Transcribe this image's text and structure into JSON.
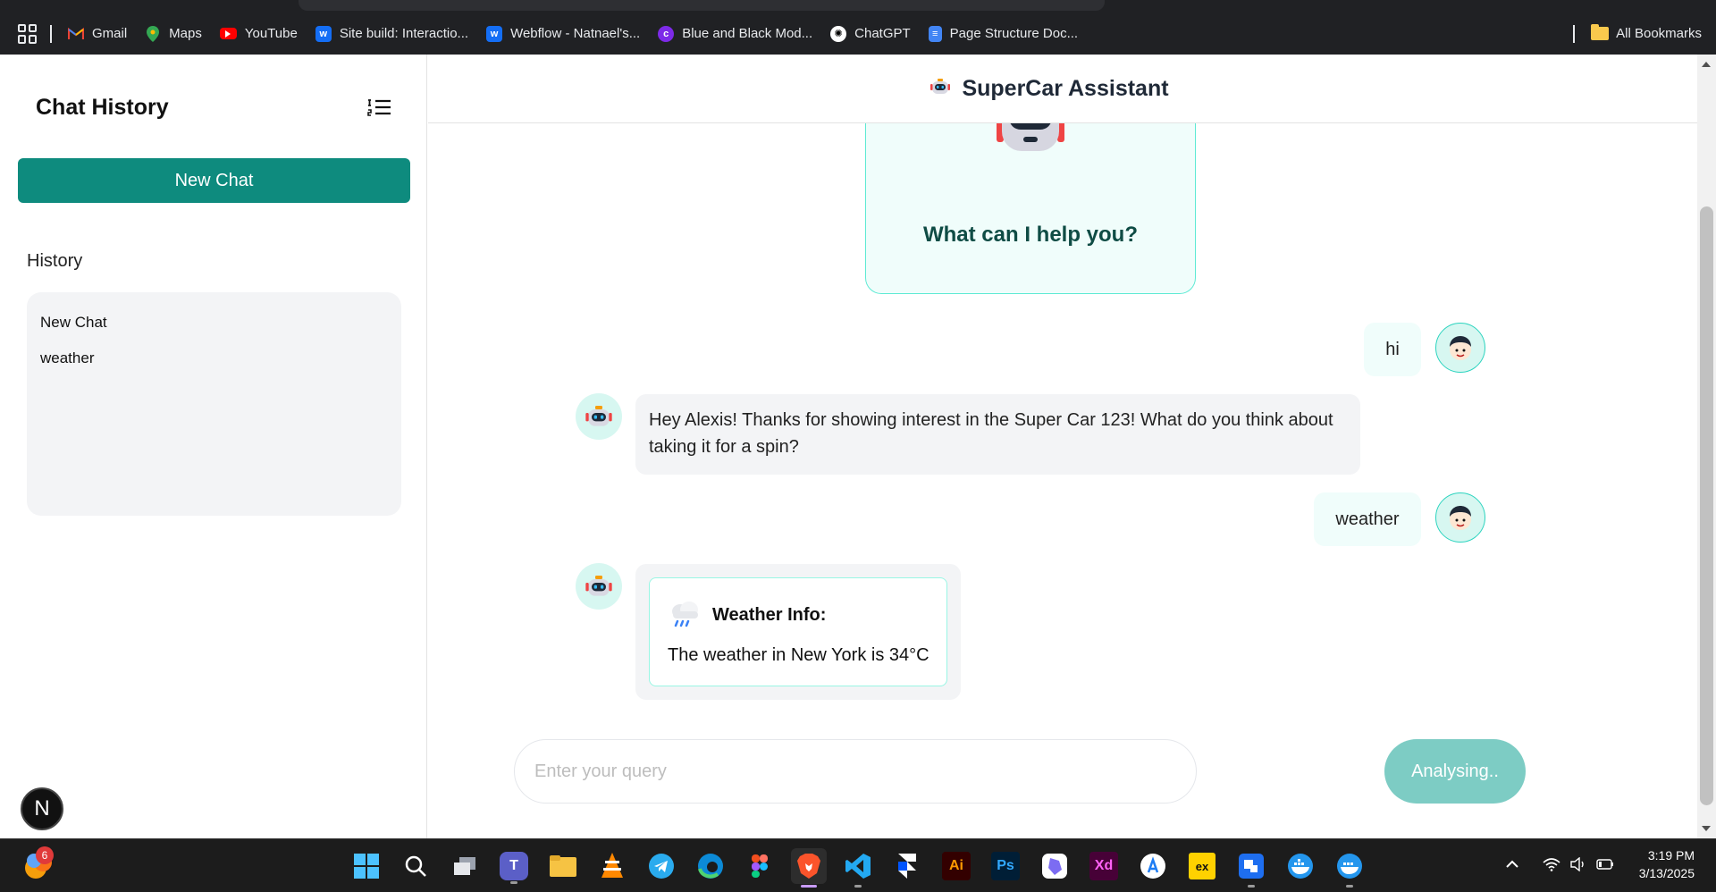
{
  "browser": {
    "bookmarks": [
      {
        "label": "Gmail",
        "icon": "gmail-icon",
        "color": "#ea4335"
      },
      {
        "label": "Maps",
        "icon": "maps-icon",
        "color": "#34a853"
      },
      {
        "label": "YouTube",
        "icon": "youtube-icon",
        "color": "#ff0000"
      },
      {
        "label": "Site build: Interactio...",
        "icon": "webflow-icon",
        "color": "#146ef5"
      },
      {
        "label": "Webflow - Natnael's...",
        "icon": "webflow-icon",
        "color": "#146ef5"
      },
      {
        "label": "Blue and Black Mod...",
        "icon": "canva-icon",
        "color": "#7d2ae8"
      },
      {
        "label": "ChatGPT",
        "icon": "chatgpt-icon",
        "color": "#ffffff"
      },
      {
        "label": "Page Structure Doc...",
        "icon": "docs-icon",
        "color": "#4285f4"
      }
    ],
    "all_bookmarks": "All Bookmarks"
  },
  "sidebar": {
    "title": "Chat History",
    "new_chat_label": "New Chat",
    "history_label": "History",
    "history_items": [
      "New Chat",
      "weather"
    ],
    "badge_letter": "N"
  },
  "header": {
    "title": "SuperCar Assistant"
  },
  "chat": {
    "welcome_prompt": "What can I help you?",
    "messages": [
      {
        "role": "user",
        "text": "hi"
      },
      {
        "role": "bot",
        "text": "Hey Alexis! Thanks for showing interest in the Super Car 123! What do you think about taking it for a spin?"
      },
      {
        "role": "user",
        "text": "weather"
      },
      {
        "role": "bot",
        "weather_title": "Weather Info:",
        "weather_text": "The weather in New York is 34°C"
      }
    ]
  },
  "composer": {
    "placeholder": "Enter your query",
    "button_label": "Analysing.."
  },
  "taskbar": {
    "notification_count": "6",
    "time": "3:19 PM",
    "date": "3/13/2025"
  },
  "colors": {
    "accent": "#0e8b7e",
    "accent_light": "#f0fdfb",
    "button_disabled": "#7dccc4"
  }
}
